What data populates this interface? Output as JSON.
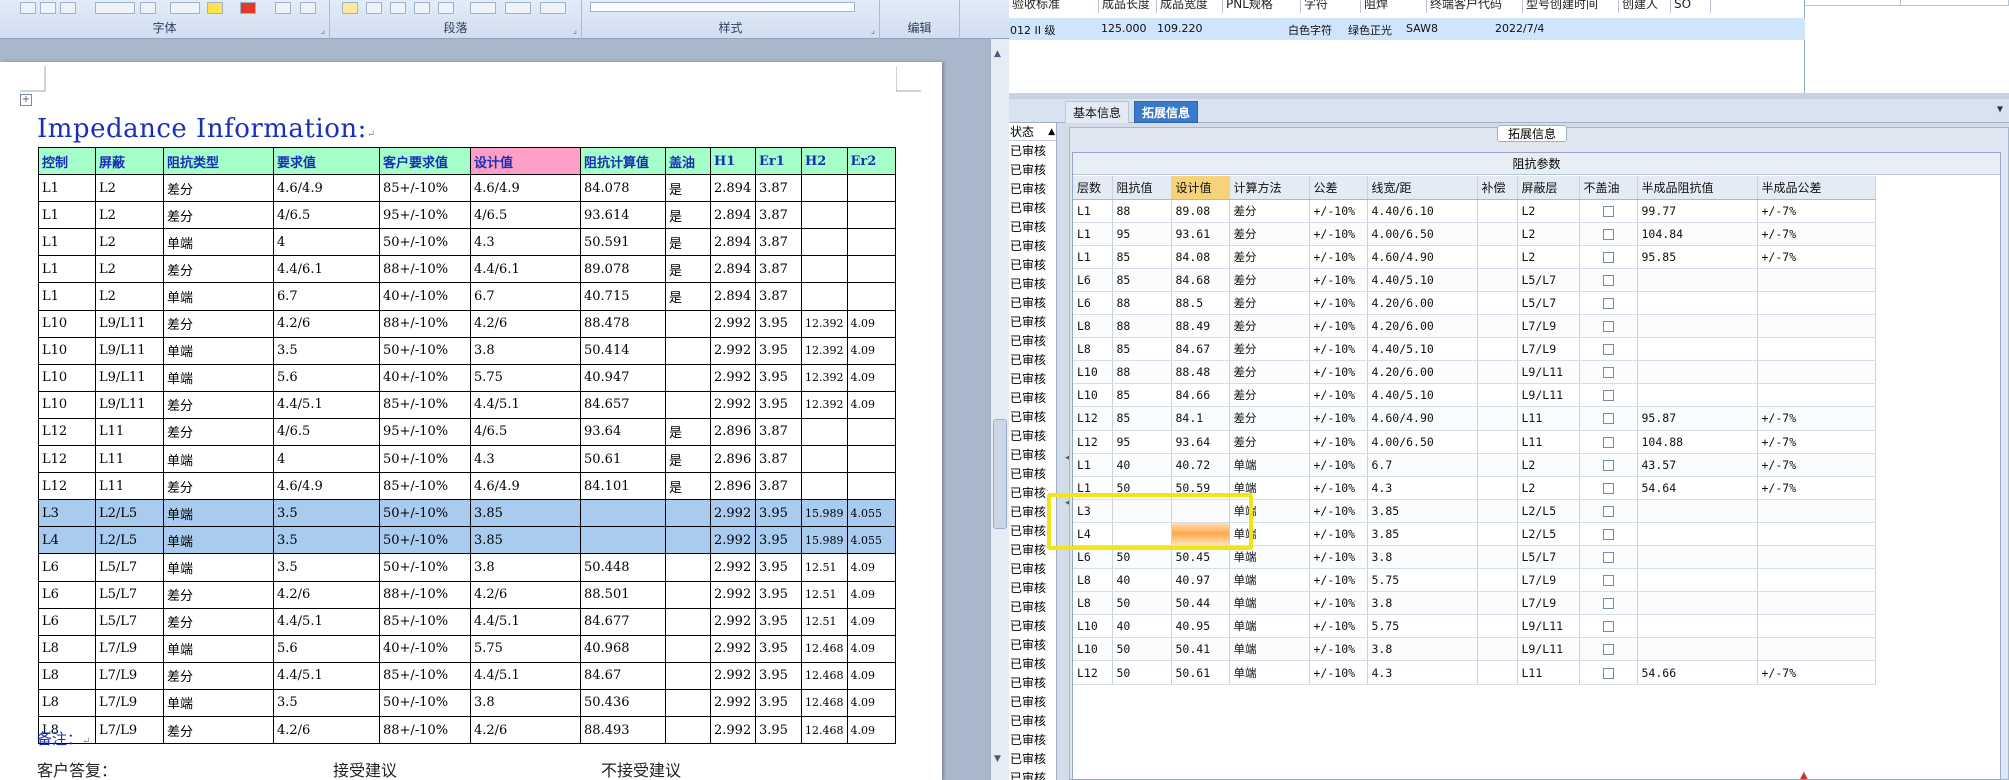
{
  "word": {
    "ribbon_groups": [
      "字体",
      "段落",
      "样式",
      "编辑"
    ],
    "doc_title": "Impedance Information:",
    "table_headers": [
      "控制",
      "屏蔽",
      "阻抗类型",
      "要求值",
      "客户要求值",
      "设计值",
      "阻抗计算值",
      "盖油",
      "H1",
      "Er1",
      "H2",
      "Er2"
    ],
    "rows": [
      [
        "L1",
        "L2",
        "差分",
        "4.6/4.9",
        "85+/-10%",
        "4.6/4.9",
        "84.078",
        "是",
        "2.894",
        "3.87",
        "",
        ""
      ],
      [
        "L1",
        "L2",
        "差分",
        "4/6.5",
        "95+/-10%",
        "4/6.5",
        "93.614",
        "是",
        "2.894",
        "3.87",
        "",
        ""
      ],
      [
        "L1",
        "L2",
        "单端",
        "4",
        "50+/-10%",
        "4.3",
        "50.591",
        "是",
        "2.894",
        "3.87",
        "",
        ""
      ],
      [
        "L1",
        "L2",
        "差分",
        "4.4/6.1",
        "88+/-10%",
        "4.4/6.1",
        "89.078",
        "是",
        "2.894",
        "3.87",
        "",
        ""
      ],
      [
        "L1",
        "L2",
        "单端",
        "6.7",
        "40+/-10%",
        "6.7",
        "40.715",
        "是",
        "2.894",
        "3.87",
        "",
        ""
      ],
      [
        "L10",
        "L9/L11",
        "差分",
        "4.2/6",
        "88+/-10%",
        "4.2/6",
        "88.478",
        "",
        "2.992",
        "3.95",
        "12.392",
        "4.09"
      ],
      [
        "L10",
        "L9/L11",
        "单端",
        "3.5",
        "50+/-10%",
        "3.8",
        "50.414",
        "",
        "2.992",
        "3.95",
        "12.392",
        "4.09"
      ],
      [
        "L10",
        "L9/L11",
        "单端",
        "5.6",
        "40+/-10%",
        "5.75",
        "40.947",
        "",
        "2.992",
        "3.95",
        "12.392",
        "4.09"
      ],
      [
        "L10",
        "L9/L11",
        "差分",
        "4.4/5.1",
        "85+/-10%",
        "4.4/5.1",
        "84.657",
        "",
        "2.992",
        "3.95",
        "12.392",
        "4.09"
      ],
      [
        "L12",
        "L11",
        "差分",
        "4/6.5",
        "95+/-10%",
        "4/6.5",
        "93.64",
        "是",
        "2.896",
        "3.87",
        "",
        ""
      ],
      [
        "L12",
        "L11",
        "单端",
        "4",
        "50+/-10%",
        "4.3",
        "50.61",
        "是",
        "2.896",
        "3.87",
        "",
        ""
      ],
      [
        "L12",
        "L11",
        "差分",
        "4.6/4.9",
        "85+/-10%",
        "4.6/4.9",
        "84.101",
        "是",
        "2.896",
        "3.87",
        "",
        ""
      ],
      [
        "L3",
        "L2/L5",
        "单端",
        "3.5",
        "50+/-10%",
        "3.85",
        "",
        "",
        "2.992",
        "3.95",
        "15.989",
        "4.055"
      ],
      [
        "L4",
        "L2/L5",
        "单端",
        "3.5",
        "50+/-10%",
        "3.85",
        "",
        "",
        "2.992",
        "3.95",
        "15.989",
        "4.055"
      ],
      [
        "L6",
        "L5/L7",
        "单端",
        "3.5",
        "50+/-10%",
        "3.8",
        "50.448",
        "",
        "2.992",
        "3.95",
        "12.51",
        "4.09"
      ],
      [
        "L6",
        "L5/L7",
        "差分",
        "4.2/6",
        "88+/-10%",
        "4.2/6",
        "88.501",
        "",
        "2.992",
        "3.95",
        "12.51",
        "4.09"
      ],
      [
        "L6",
        "L5/L7",
        "差分",
        "4.4/5.1",
        "85+/-10%",
        "4.4/5.1",
        "84.677",
        "",
        "2.992",
        "3.95",
        "12.51",
        "4.09"
      ],
      [
        "L8",
        "L7/L9",
        "单端",
        "5.6",
        "40+/-10%",
        "5.75",
        "40.968",
        "",
        "2.992",
        "3.95",
        "12.468",
        "4.09"
      ],
      [
        "L8",
        "L7/L9",
        "差分",
        "4.4/5.1",
        "85+/-10%",
        "4.4/5.1",
        "84.67",
        "",
        "2.992",
        "3.95",
        "12.468",
        "4.09"
      ],
      [
        "L8",
        "L7/L9",
        "单端",
        "3.5",
        "50+/-10%",
        "3.8",
        "50.436",
        "",
        "2.992",
        "3.95",
        "12.468",
        "4.09"
      ],
      [
        "L8",
        "L7/L9",
        "差分",
        "4.2/6",
        "88+/-10%",
        "4.2/6",
        "88.493",
        "",
        "2.992",
        "3.95",
        "12.468",
        "4.09"
      ]
    ],
    "selected_rows": [
      12,
      13
    ],
    "notes_label": "备注：",
    "reply_label": "客户答复：",
    "accept_label": "接受建议",
    "reject_label": "不接受建议"
  },
  "erp": {
    "top_headers": [
      "验收标准",
      "成品长度",
      "成品宽度",
      "PNL规格",
      "字符",
      "阻焊",
      "终端客户代码",
      "型号创建时间",
      "创建人",
      "SO"
    ],
    "top_row": {
      "grade": "012 II 级",
      "length": "125.000",
      "width": "109.220",
      "char": "白色字符",
      "mask": "绿色正光",
      "code": "SAW8",
      "date": "2022/7/4"
    },
    "tabs": [
      "基本信息",
      "拓展信息"
    ],
    "active_tab": "拓展信息",
    "status_header": "状态",
    "status_items": [
      "已审核",
      "已审核",
      "已审核",
      "已审核",
      "已审核",
      "已审核",
      "已审核",
      "已审核",
      "已审核",
      "已审核",
      "已审核",
      "已审核",
      "已审核",
      "已审核",
      "已审核",
      "已审核",
      "已审核",
      "已审核",
      "已审核",
      "已审核",
      "已审核",
      "已审核",
      "已审核",
      "已审核",
      "已审核",
      "已审核",
      "已审核",
      "已审核",
      "已审核",
      "已审核",
      "已审核",
      "已审核",
      "已审核",
      "已审核"
    ],
    "legend": "拓展信息",
    "grid_title": "阻抗参数",
    "columns": [
      "层数",
      "阻抗值",
      "设计值",
      "计算方法",
      "公差",
      "线宽/距",
      "补偿",
      "屏蔽层",
      "不盖油",
      "半成品阻抗值",
      "半成品公差"
    ],
    "rows": [
      [
        "L1",
        "88",
        "89.08",
        "差分",
        "+/-10%",
        "4.40/6.10",
        "",
        "L2",
        "",
        "99.77",
        "+/-7%"
      ],
      [
        "L1",
        "95",
        "93.61",
        "差分",
        "+/-10%",
        "4.00/6.50",
        "",
        "L2",
        "",
        "104.84",
        "+/-7%"
      ],
      [
        "L1",
        "85",
        "84.08",
        "差分",
        "+/-10%",
        "4.60/4.90",
        "",
        "L2",
        "",
        "95.85",
        "+/-7%"
      ],
      [
        "L6",
        "85",
        "84.68",
        "差分",
        "+/-10%",
        "4.40/5.10",
        "",
        "L5/L7",
        "",
        "",
        ""
      ],
      [
        "L6",
        "88",
        "88.5",
        "差分",
        "+/-10%",
        "4.20/6.00",
        "",
        "L5/L7",
        "",
        "",
        ""
      ],
      [
        "L8",
        "88",
        "88.49",
        "差分",
        "+/-10%",
        "4.20/6.00",
        "",
        "L7/L9",
        "",
        "",
        ""
      ],
      [
        "L8",
        "85",
        "84.67",
        "差分",
        "+/-10%",
        "4.40/5.10",
        "",
        "L7/L9",
        "",
        "",
        ""
      ],
      [
        "L10",
        "88",
        "88.48",
        "差分",
        "+/-10%",
        "4.20/6.00",
        "",
        "L9/L11",
        "",
        "",
        ""
      ],
      [
        "L10",
        "85",
        "84.66",
        "差分",
        "+/-10%",
        "4.40/5.10",
        "",
        "L9/L11",
        "",
        "",
        ""
      ],
      [
        "L12",
        "85",
        "84.1",
        "差分",
        "+/-10%",
        "4.60/4.90",
        "",
        "L11",
        "",
        "95.87",
        "+/-7%"
      ],
      [
        "L12",
        "95",
        "93.64",
        "差分",
        "+/-10%",
        "4.00/6.50",
        "",
        "L11",
        "",
        "104.88",
        "+/-7%"
      ],
      [
        "L1",
        "40",
        "40.72",
        "单端",
        "+/-10%",
        "6.7",
        "",
        "L2",
        "",
        "43.57",
        "+/-7%"
      ],
      [
        "L1",
        "50",
        "50.59",
        "单端",
        "+/-10%",
        "4.3",
        "",
        "L2",
        "",
        "54.64",
        "+/-7%"
      ],
      [
        "L3",
        "",
        "",
        "单端",
        "+/-10%",
        "3.85",
        "",
        "L2/L5",
        "",
        "",
        ""
      ],
      [
        "L4",
        "",
        "",
        "单端",
        "+/-10%",
        "3.85",
        "",
        "L2/L5",
        "",
        "",
        ""
      ],
      [
        "L6",
        "50",
        "50.45",
        "单端",
        "+/-10%",
        "3.8",
        "",
        "L5/L7",
        "",
        "",
        ""
      ],
      [
        "L8",
        "40",
        "40.97",
        "单端",
        "+/-10%",
        "5.75",
        "",
        "L7/L9",
        "",
        "",
        ""
      ],
      [
        "L8",
        "50",
        "50.44",
        "单端",
        "+/-10%",
        "3.8",
        "",
        "L7/L9",
        "",
        "",
        ""
      ],
      [
        "L10",
        "40",
        "40.95",
        "单端",
        "+/-10%",
        "5.75",
        "",
        "L9/L11",
        "",
        "",
        ""
      ],
      [
        "L10",
        "50",
        "50.41",
        "单端",
        "+/-10%",
        "3.8",
        "",
        "L9/L11",
        "",
        "",
        ""
      ],
      [
        "L12",
        "50",
        "50.61",
        "单端",
        "+/-10%",
        "4.3",
        "",
        "L11",
        "",
        "54.66",
        "+/-7%"
      ]
    ],
    "highlight_color": "#f2e418",
    "accent": "#3a79c9"
  }
}
